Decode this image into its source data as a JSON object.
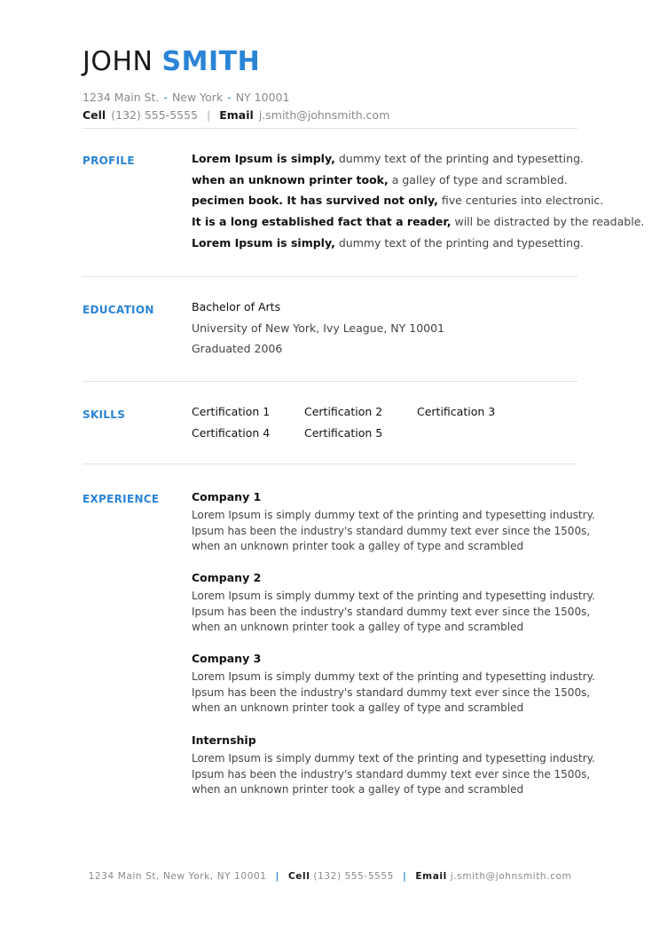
{
  "header": {
    "first_name": "JOHN",
    "last_name": "SMITH",
    "address": {
      "street": "1234 Main St.",
      "city": "New York",
      "state_zip": "NY 10001"
    },
    "cell_label": "Cell",
    "cell": "(132) 555-5555",
    "email_label": "Email",
    "email": "j.smith@johnsmith.com"
  },
  "profile": {
    "title": "PROFILE",
    "lines": [
      {
        "bold": "Lorem Ipsum is simply,",
        "rest": " dummy text of the printing and typesetting."
      },
      {
        "bold": "when an unknown printer took,",
        "rest": " a galley of type and scrambled."
      },
      {
        "bold": "pecimen book. It has survived not only,",
        "rest": " five centuries into electronic."
      },
      {
        "bold": "It is a long established fact that a reader,",
        "rest": " will be distracted by the readable."
      },
      {
        "bold": "Lorem Ipsum is simply,",
        "rest": " dummy text of the printing and typesetting."
      }
    ]
  },
  "education": {
    "title": "EDUCATION",
    "degree": "Bachelor of Arts",
    "school": "University of New York, Ivy League, NY 10001",
    "graduated": "Graduated 2006"
  },
  "skills": {
    "title": "SKILLS",
    "items": [
      "Certification 1",
      "Certification 2",
      "Certification 3",
      "Certification 4",
      "Certification 5"
    ]
  },
  "experience": {
    "title": "EXPERIENCE",
    "jobs": [
      {
        "title": "Company 1",
        "lines": [
          "Lorem Ipsum is simply dummy text of the printing and typesetting industry.",
          "Ipsum has been the industry's standard dummy text ever since the 1500s,",
          "when an unknown printer took a galley of type and scrambled"
        ]
      },
      {
        "title": "Company 2",
        "lines": [
          "Lorem Ipsum is simply dummy text of the printing and typesetting industry.",
          "Ipsum has been the industry's standard dummy text ever since the 1500s,",
          "when an unknown printer took a galley of type and scrambled"
        ]
      },
      {
        "title": "Company 3",
        "lines": [
          "Lorem Ipsum is simply dummy text of the printing and typesetting industry.",
          "Ipsum has been the industry's standard dummy text ever since the 1500s,",
          "when an unknown printer took a galley of type and scrambled"
        ]
      },
      {
        "title": "Internship",
        "lines": [
          "Lorem Ipsum is simply dummy text of the printing and typesetting industry.",
          "Ipsum has been the industry's standard dummy text ever since the 1500s,",
          "when an unknown printer took a galley of type and scrambled"
        ]
      }
    ]
  },
  "footer": {
    "address": "1234 Main St, New York, NY 10001",
    "cell_label": "Cell",
    "cell": "(132) 555-5555",
    "email_label": "Email",
    "email": "j.smith@johnsmith.com"
  },
  "colors": {
    "accent": "#2a84d6",
    "text": "#222222",
    "muted": "#8a8a8a",
    "rule": "#e2e2e2"
  }
}
